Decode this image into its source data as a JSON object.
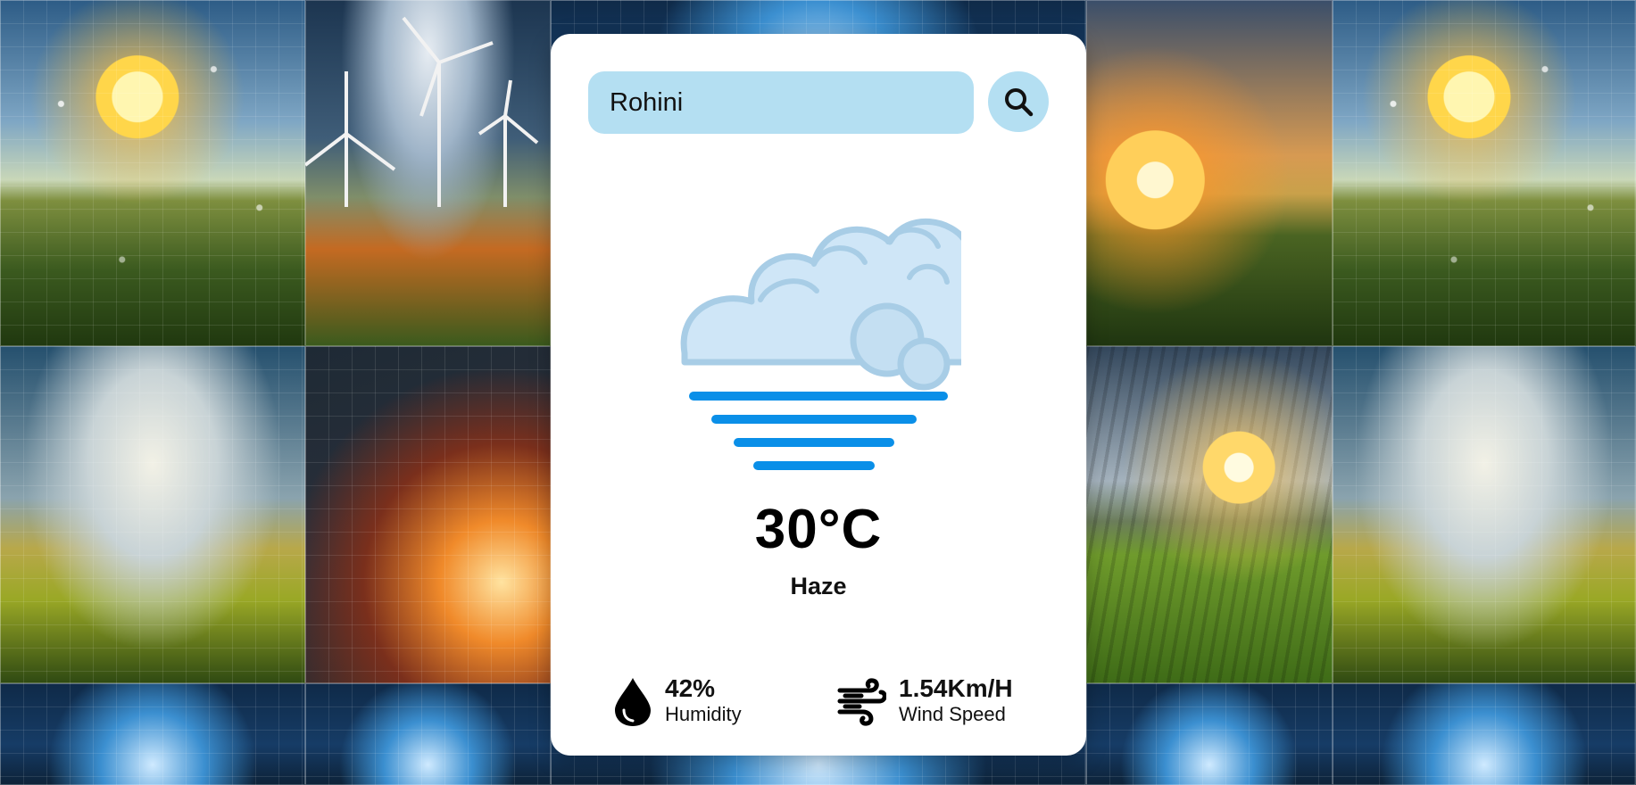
{
  "search": {
    "value": "Rohini",
    "icon": "search-icon"
  },
  "weather": {
    "icon": "haze-icon",
    "temperature": "30°C",
    "condition": "Haze"
  },
  "details": {
    "humidity": {
      "icon": "water-drop-icon",
      "value": "42%",
      "label": "Humidity"
    },
    "wind": {
      "icon": "wind-icon",
      "value": "1.54Km/H",
      "label": "Wind Speed"
    }
  },
  "colors": {
    "card": "#ffffff",
    "input_bg": "#b4dff2",
    "cloud_fill": "#cfe6f7",
    "cloud_stroke": "#a8cde6",
    "haze_lines": "#0a8fe8"
  }
}
